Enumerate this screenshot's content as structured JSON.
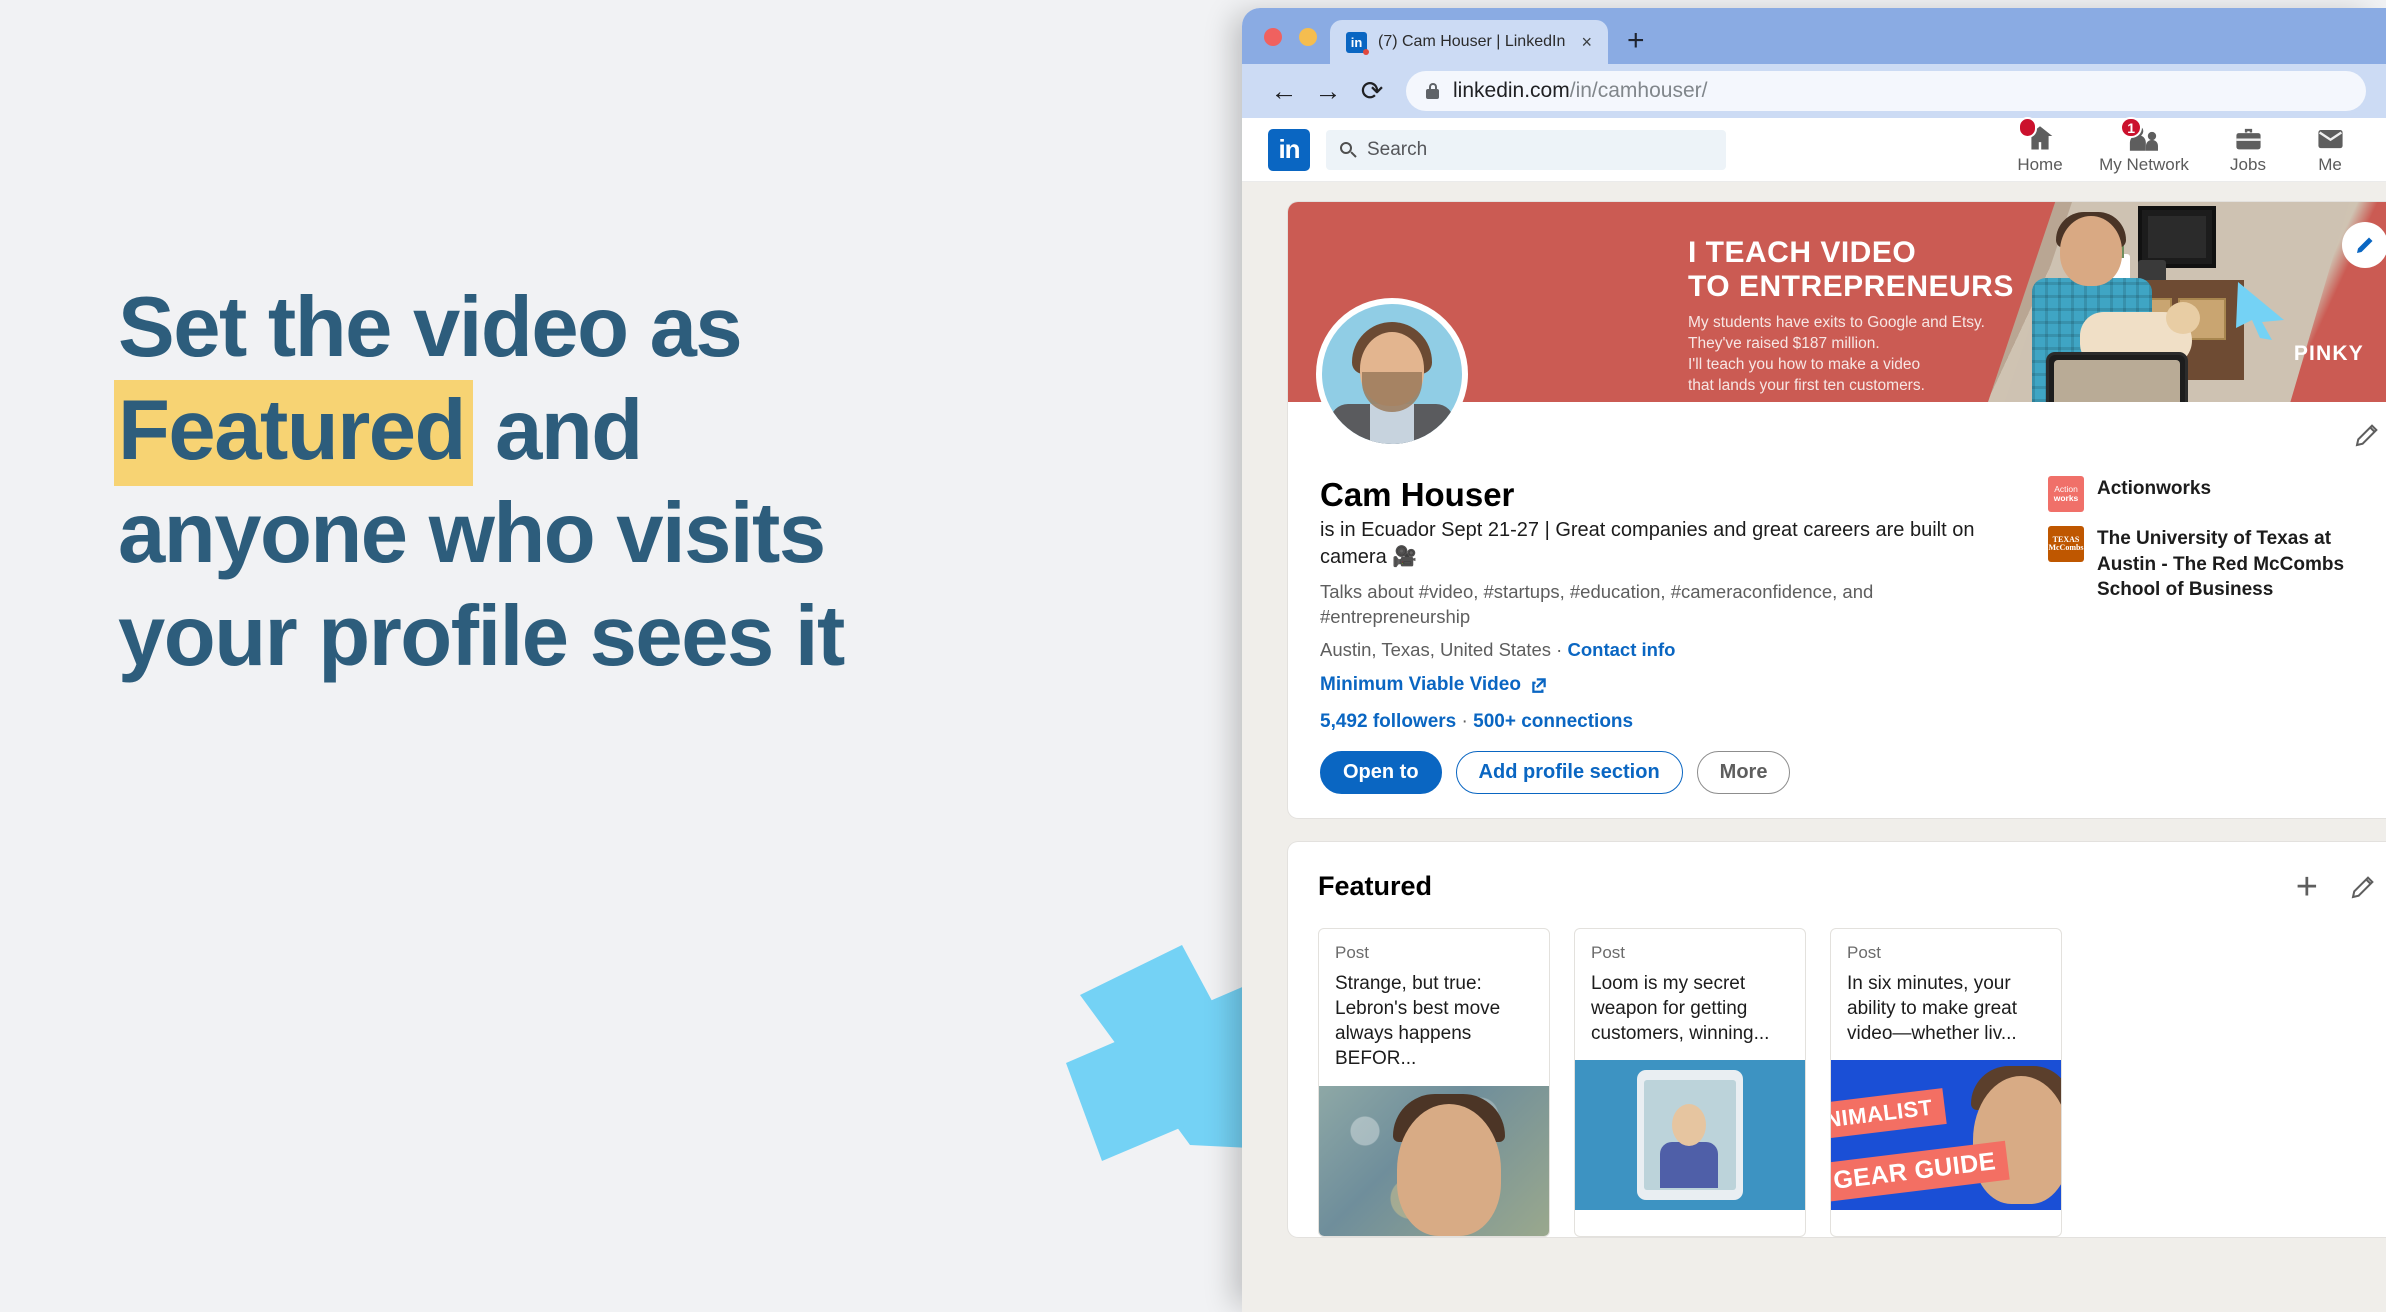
{
  "slide": {
    "headline_lines": [
      "Set the video as",
      "Featured",
      " and",
      "anyone who visits",
      "your profile sees it"
    ],
    "headline_l1": "Set the video as",
    "headline_highlight": "Featured",
    "headline_after_highlight": " and",
    "headline_l3": "anyone who visits",
    "headline_l4": "your profile sees it",
    "text_color": "#2d5d7c",
    "highlight_color": "#f7d373",
    "background_color": "#f1f2f4",
    "arrow_color": "#74d2f5"
  },
  "browser": {
    "tab": {
      "title": "(7) Cam Houser | LinkedIn",
      "favicon": "in",
      "close_label": "×"
    },
    "new_tab_label": "+",
    "back_label": "←",
    "forward_label": "→",
    "reload_label": "⟳",
    "url_domain": "linkedin.com",
    "url_path": "/in/camhouser/",
    "chrome_color": "#8aabe3",
    "toolbar_color": "#ccdbf4"
  },
  "linkedin": {
    "logo": "in",
    "search": {
      "placeholder": "Search"
    },
    "nav": [
      {
        "label": "Home",
        "icon": "home-icon",
        "badge": ""
      },
      {
        "label": "My Network",
        "icon": "network-icon",
        "badge": "1"
      },
      {
        "label": "Jobs",
        "icon": "briefcase-icon",
        "badge": ""
      },
      {
        "label": "Me",
        "icon": "me-icon",
        "badge": ""
      }
    ],
    "banner": {
      "headline_line1": "I TEACH VIDEO",
      "headline_line2": "TO ENTREPRENEURS",
      "sub_line1": "My students have exits to Google and Etsy.",
      "sub_line2": "They've raised $187 million.",
      "sub_line3": "I'll teach you how to make a video",
      "sub_line4": "that lands your first ten customers.",
      "cat_label": "PINKY",
      "background_color": "#cb5b53"
    },
    "profile": {
      "name": "Cam Houser",
      "headline": "is in Ecuador Sept 21-27 | Great companies and great careers are built on camera 🎥",
      "talks_about": "Talks about #video, #startups, #education, #cameraconfidence, and #entrepreneurship",
      "location": "Austin, Texas, United States",
      "location_separator": " · ",
      "contact_info": "Contact info",
      "website_link": "Minimum Viable Video",
      "followers": "5,492 followers",
      "connections_separator": " · ",
      "connections": "500+ connections",
      "buttons": [
        {
          "label": "Open to",
          "style": "primary"
        },
        {
          "label": "Add profile section",
          "style": "outline"
        },
        {
          "label": "More",
          "style": "ghost"
        }
      ],
      "experience": [
        {
          "name": "Actionworks",
          "logo_line1": "Action",
          "logo_line2": "works"
        },
        {
          "name": "The University of Texas at Austin - The Red McCombs School of Business",
          "logo_line1": "TEXAS",
          "logo_line2": "McCombs"
        }
      ]
    },
    "featured": {
      "title": "Featured",
      "add_label": "+",
      "items": [
        {
          "type": "Post",
          "text": "Strange, but true: Lebron's best move always happens BEFOR..."
        },
        {
          "type": "Post",
          "text": "Loom is my secret weapon for getting customers, winning..."
        },
        {
          "type": "Post",
          "text": "In six minutes, your ability to make great video—whether liv...",
          "overlay1": "NIMALIST",
          "overlay2": "GEAR GUIDE"
        }
      ]
    }
  }
}
